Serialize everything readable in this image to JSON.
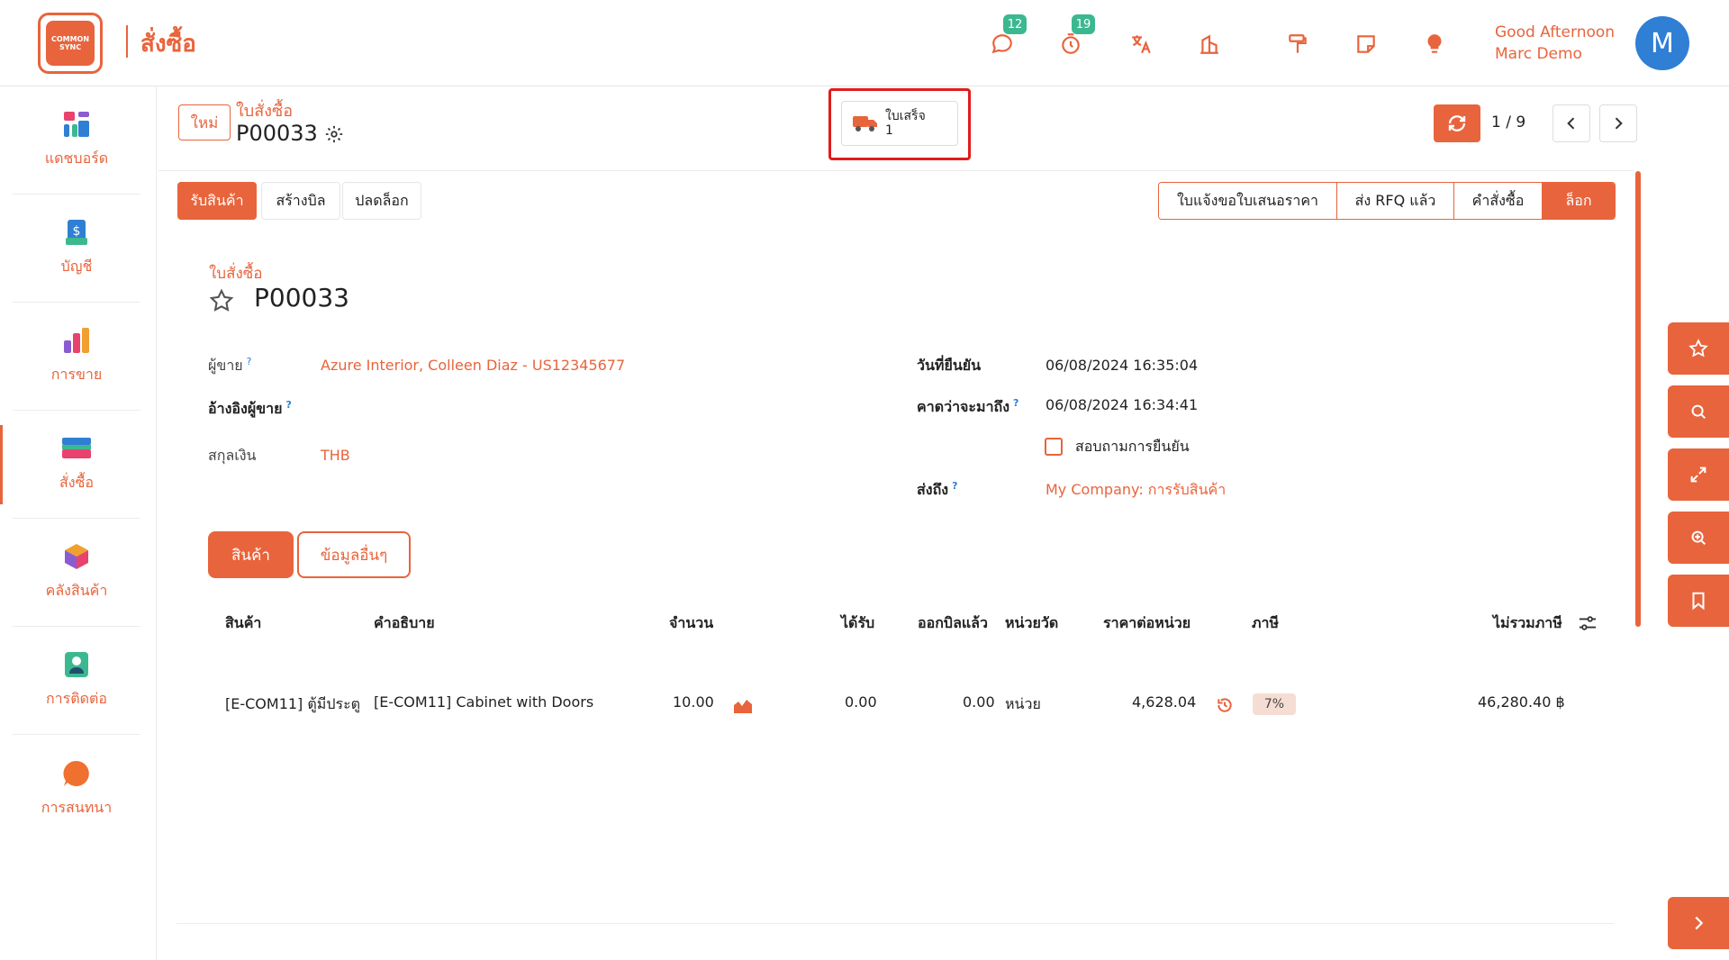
{
  "app": {
    "logo_text": "COMMON SYNC",
    "module_title": "สั่งซื้อ"
  },
  "topbar": {
    "messages_count": "12",
    "activities_count": "19",
    "greeting_line1": "Good Afternoon",
    "greeting_line2": "Marc Demo",
    "avatar_initial": "M"
  },
  "sidebar": {
    "items": [
      {
        "label": "แดชบอร์ด",
        "icon": "dashboard-icon"
      },
      {
        "label": "บัญชี",
        "icon": "accounting-icon"
      },
      {
        "label": "การขาย",
        "icon": "sales-icon"
      },
      {
        "label": "สั่งซื้อ",
        "icon": "purchase-icon"
      },
      {
        "label": "คลังสินค้า",
        "icon": "inventory-icon"
      },
      {
        "label": "การติดต่อ",
        "icon": "contacts-icon"
      },
      {
        "label": "การสนทนา",
        "icon": "discuss-icon"
      }
    ]
  },
  "control_panel": {
    "new_label": "ใหม่",
    "breadcrumb_parent": "ใบสั่งซื้อ",
    "breadcrumb_current": "P00033",
    "smart_button": {
      "label": "ใบเสร็จ",
      "count": "1"
    },
    "pager": "1 / 9"
  },
  "statusbar": {
    "actions": [
      "รับสินค้า",
      "สร้างบิล",
      "ปลดล็อก"
    ],
    "steps": [
      "ใบแจ้งขอใบเสนอราคา",
      "ส่ง RFQ แล้ว",
      "คำสั่งซื้อ",
      "ล็อก"
    ],
    "active_step": "ล็อก"
  },
  "form": {
    "subtitle": "ใบสั่งซื้อ",
    "title": "P00033",
    "vendor_label": "ผู้ขาย",
    "vendor_value": "Azure Interior, Colleen Diaz - US12345677",
    "vendor_ref_label": "อ้างอิงผู้ขาย",
    "currency_label": "สกุลเงิน",
    "currency_value": "THB",
    "confirm_date_label": "วันที่ยืนยัน",
    "confirm_date_value": "06/08/2024 16:35:04",
    "expected_arrival_label": "คาดว่าจะมาถึง",
    "expected_arrival_value": "06/08/2024 16:34:41",
    "ask_confirm_label": "สอบถามการยืนยัน",
    "deliver_to_label": "ส่งถึง",
    "deliver_to_value": "My Company: การรับสินค้า",
    "help_mark": "?"
  },
  "notebook": {
    "tabs": [
      "สินค้า",
      "ข้อมูลอื่นๆ"
    ]
  },
  "order_lines": {
    "headers": [
      "สินค้า",
      "คำอธิบาย",
      "จำนวน",
      "ได้รับ",
      "ออกบิลแล้ว",
      "หน่วยวัด",
      "ราคาต่อหน่วย",
      "ภาษี",
      "ไม่รวมภาษี"
    ],
    "rows": [
      {
        "product": "[E-COM11] ตู้มีประตู",
        "description": "[E-COM11] Cabinet with Doors",
        "quantity": "10.00",
        "received": "0.00",
        "billed": "0.00",
        "uom": "หน่วย",
        "unit_price": "4,628.04",
        "tax": "7%",
        "subtotal": "46,280.40 ฿"
      }
    ]
  },
  "colors": {
    "accent": "#e8643c",
    "highlight": "#e31b1b",
    "badge": "#3cb890",
    "avatar": "#2f7fd4"
  }
}
